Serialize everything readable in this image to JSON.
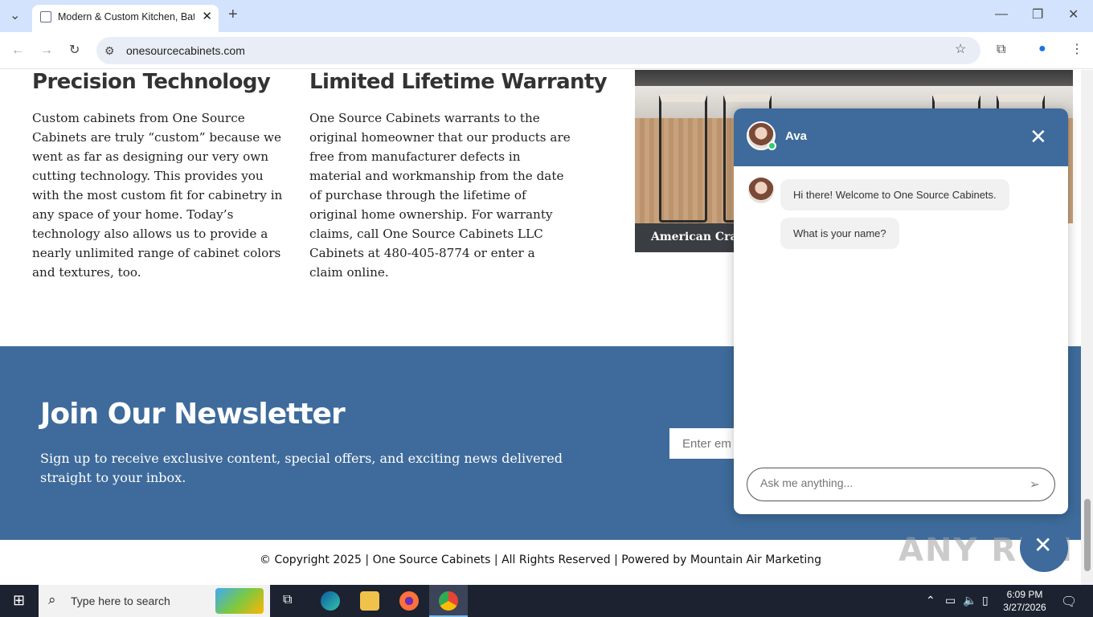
{
  "browser": {
    "tab_title": "Modern & Custom Kitchen, Bat",
    "url": "onesourcecabinets.com"
  },
  "columns": [
    {
      "heading": "Precision Technology",
      "text": "Custom cabinets from One Source Cabinets are truly “custom” because we went as far as designing our very own cutting technology. This provides you with the most custom fit for cabinetry in any space of your home. Today’s technology also allows us to provide a nearly unlimited range of cabinet colors and textures, too."
    },
    {
      "heading": "Limited Lifetime Warranty",
      "text": "One Source Cabinets warrants to the original homeowner that our products are free from manufacturer defects in material and workmanship from the date of purchase through the lifetime of original home ownership. For warranty claims, call One Source Cabinets LLC Cabinets at 480-405-8774 or enter a claim online."
    }
  ],
  "photo": {
    "caption": "American Craft"
  },
  "newsletter": {
    "title": "Join Our Newsletter",
    "text": "Sign up to receive exclusive content, special offers, and exciting news delivered straight to your inbox.",
    "email_placeholder": "Enter em"
  },
  "footer": {
    "text": "© Copyright 2025 | One Source Cabinets | All Rights Reserved | Powered by Mountain Air Marketing"
  },
  "chat": {
    "agent_name": "Ava",
    "messages": [
      "Hi there! Welcome to One Source Cabinets.",
      "What is your name?"
    ],
    "input_placeholder": "Ask me anything...",
    "close_glyph": "✕"
  },
  "watermark": "ANY RUN",
  "taskbar": {
    "search_placeholder": "Type here to search",
    "time": "6:09 PM",
    "date": "3/27/2026"
  },
  "colors": {
    "brand_blue": "#3e6b9b",
    "tab_bar": "#d3e3fd",
    "taskbar": "#1c2230"
  }
}
